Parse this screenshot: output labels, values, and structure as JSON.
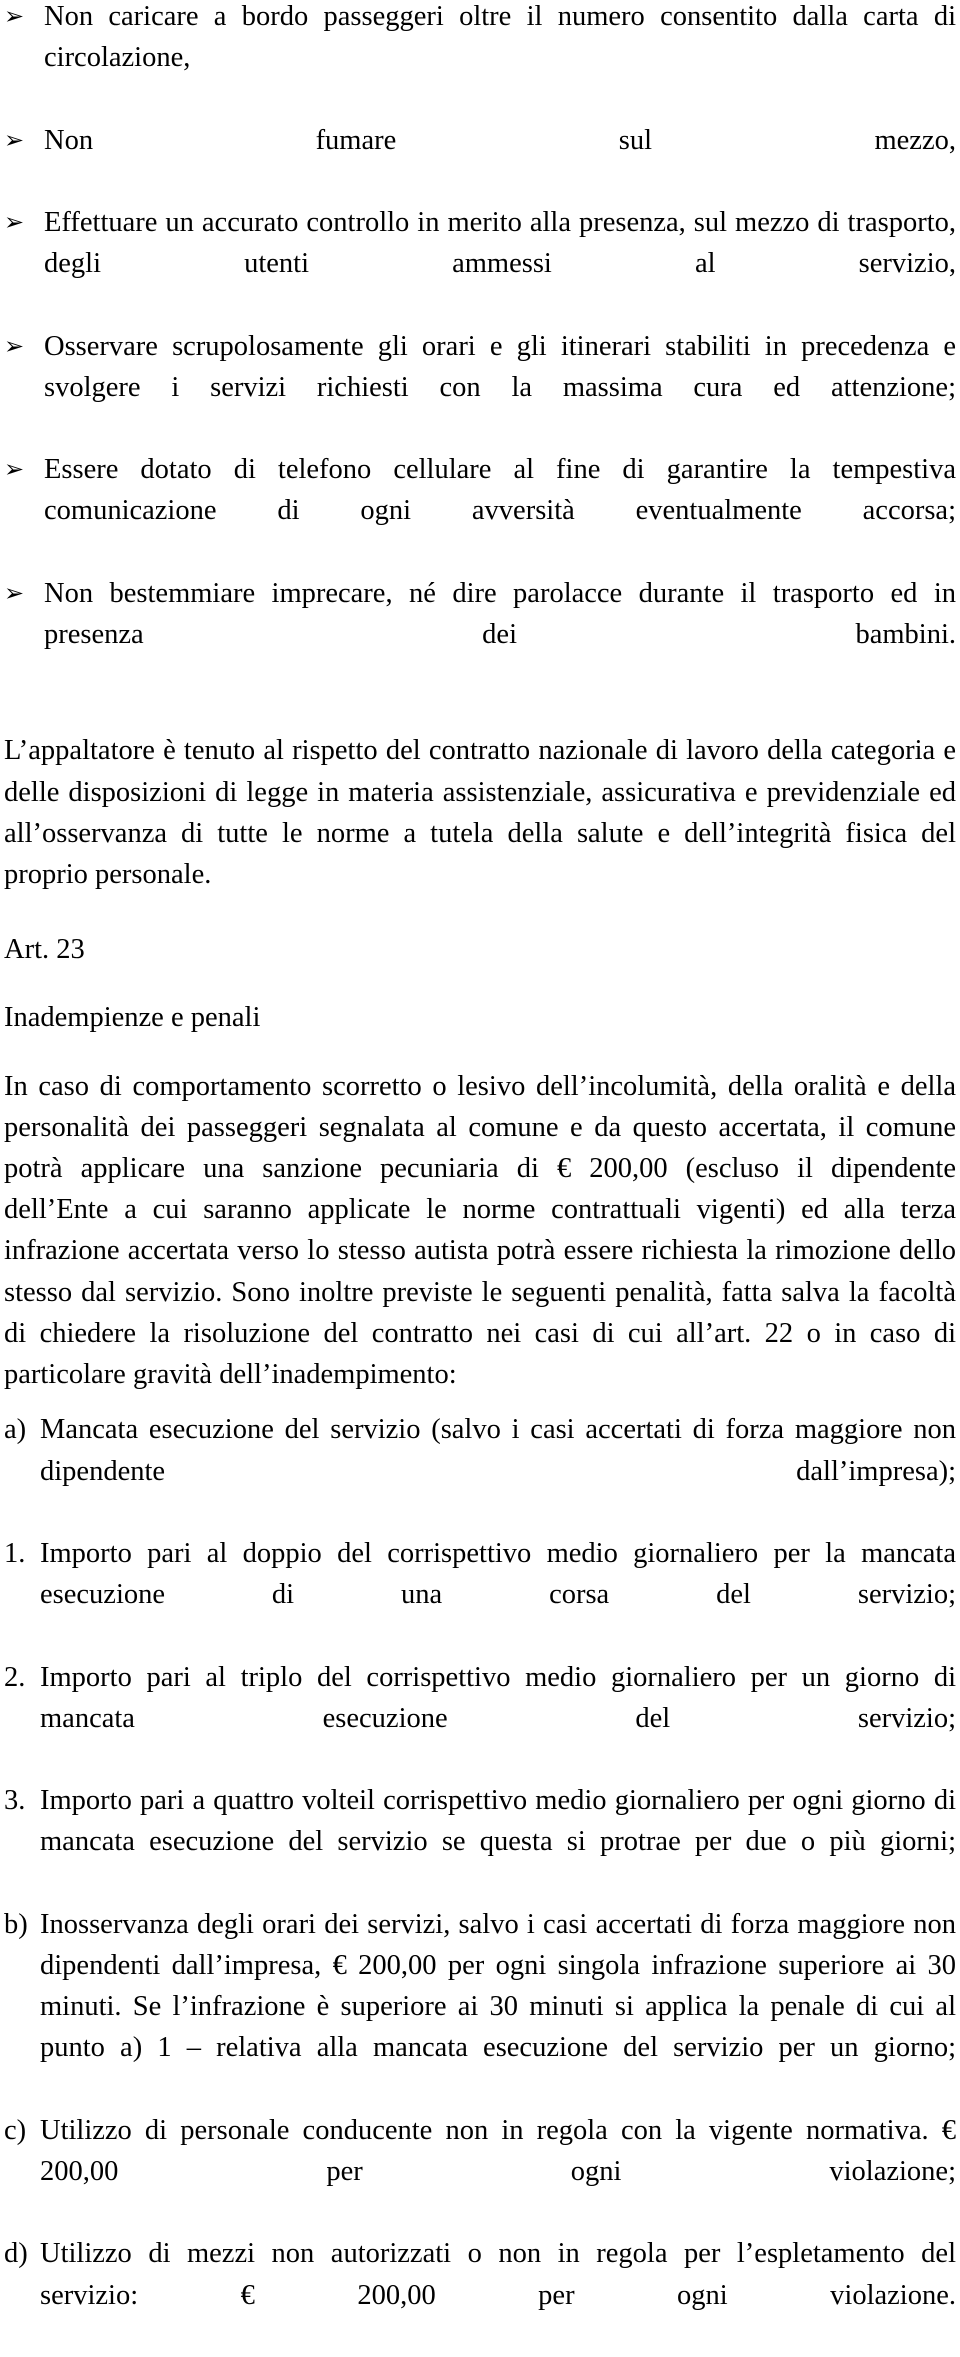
{
  "document": {
    "bullet_glyph": "➢",
    "bullet_list": [
      "Non caricare a bordo passeggeri oltre il numero consentito dalla carta di circolazione,",
      "Non fumare sul mezzo,",
      "Effettuare un accurato controllo in merito alla presenza, sul mezzo di trasporto, degli utenti ammessi al servizio,",
      "Osservare scrupolosamente gli orari e gli itinerari stabiliti in precedenza e svolgere i servizi richiesti con la massima cura ed attenzione;",
      "Essere dotato di telefono cellulare al fine di garantire la tempestiva comunicazione di ogni avversità eventualmente accorsa;",
      "Non bestemmiare imprecare, né dire parolacce durante il trasporto ed in presenza dei bambini."
    ],
    "paragraph_appaltatore": "L’appaltatore è tenuto al rispetto del contratto nazionale di lavoro della categoria e delle disposizioni di legge in materia assistenziale, assicurativa e previdenziale ed all’osservanza di tutte le norme a tutela della salute e dell’integrità fisica del proprio personale.",
    "article_number": "Art. 23",
    "article_title": "Inadempienze e penali",
    "paragraph_penali": "In caso di comportamento scorretto o lesivo dell’incolumità, della oralità e della personalità dei passeggeri segnalata al comune e da questo accertata, il comune potrà applicare una sanzione pecuniaria di € 200,00 (escluso il dipendente dell’Ente a cui saranno applicate le norme contrattuali vigenti) ed alla terza infrazione accertata verso lo stesso autista potrà essere richiesta la rimozione dello stesso dal servizio. Sono inoltre previste le seguenti penalità, fatta salva la facoltà di chiedere la risoluzione del contratto nei casi di cui all’art. 22 o in caso di particolare gravità dell’inadempimento:",
    "penalty_items": [
      {
        "marker": "a)",
        "text": "Mancata esecuzione del servizio (salvo i casi accertati di forza maggiore non dipendente dall’impresa);"
      },
      {
        "marker": "1.",
        "text": "Importo pari al doppio del corrispettivo medio giornaliero per la mancata esecuzione di una corsa del servizio;"
      },
      {
        "marker": "2.",
        "text": "Importo pari al triplo del corrispettivo medio giornaliero per un giorno di mancata esecuzione del servizio;"
      },
      {
        "marker": "3.",
        "text": "Importo pari a quattro volteil corrispettivo medio giornaliero per ogni giorno di mancata esecuzione del servizio se questa si protrae per due o più giorni;"
      },
      {
        "marker": "b)",
        "text": "Inosservanza degli orari dei servizi, salvo i casi accertati di forza maggiore non dipendenti dall’impresa, € 200,00 per ogni singola infrazione superiore ai 30 minuti. Se l’infrazione è superiore ai 30 minuti si applica la penale di cui al punto a) 1 – relativa alla mancata esecuzione del servizio per un giorno;"
      },
      {
        "marker": "c)",
        "text": "Utilizzo di personale conducente non in regola con la vigente normativa. € 200,00 per ogni violazione;"
      },
      {
        "marker": "d)",
        "text": "Utilizzo di mezzi non autorizzati o non in regola per l’espletamento del servizio: € 200,00 per ogni violazione."
      }
    ]
  }
}
